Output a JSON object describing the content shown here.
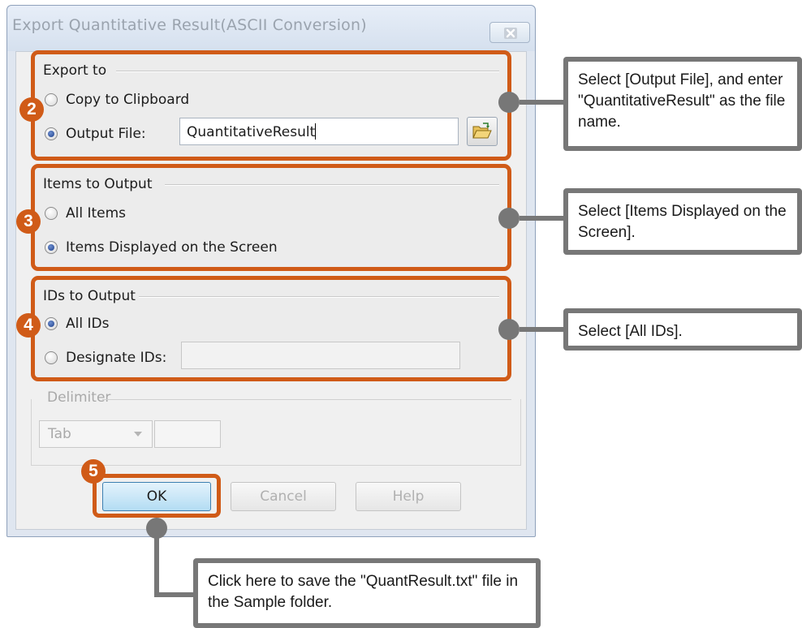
{
  "dialog": {
    "title": "Export Quantitative Result(ASCII Conversion)",
    "export_to": {
      "title": "Export to",
      "copy_to_clipboard": "Copy to Clipboard",
      "output_file_label": "Output File:",
      "output_file_value": "QuantitativeResult"
    },
    "items_to_output": {
      "title": "Items to Output",
      "all_items": "All Items",
      "items_displayed": "Items Displayed on the Screen"
    },
    "ids_to_output": {
      "title": "IDs to Output",
      "all_ids": "All IDs",
      "designate_ids": "Designate IDs:",
      "designate_value": ""
    },
    "delimiter": {
      "title": "Delimiter",
      "selected": "Tab"
    },
    "buttons": {
      "ok": "OK",
      "cancel": "Cancel",
      "help": "Help"
    }
  },
  "steps": {
    "step2": "2",
    "step3": "3",
    "step4": "4",
    "step5": "5"
  },
  "callouts": {
    "output_file": "Select [Output File], and enter \"QuantitativeResult\" as the file name.",
    "items_displayed": "Select [Items Displayed on the Screen].",
    "all_ids": "Select [All IDs].",
    "ok_save": "Click here to save the \"QuantResult.txt\" file in the Sample folder."
  },
  "colors": {
    "highlight": "#d05b18",
    "callout_border": "#777777",
    "ok_button": "#b3dcf3"
  },
  "icons": {
    "close": "close-icon",
    "browse": "folder-open-icon",
    "dropdown": "chevron-down-icon"
  }
}
